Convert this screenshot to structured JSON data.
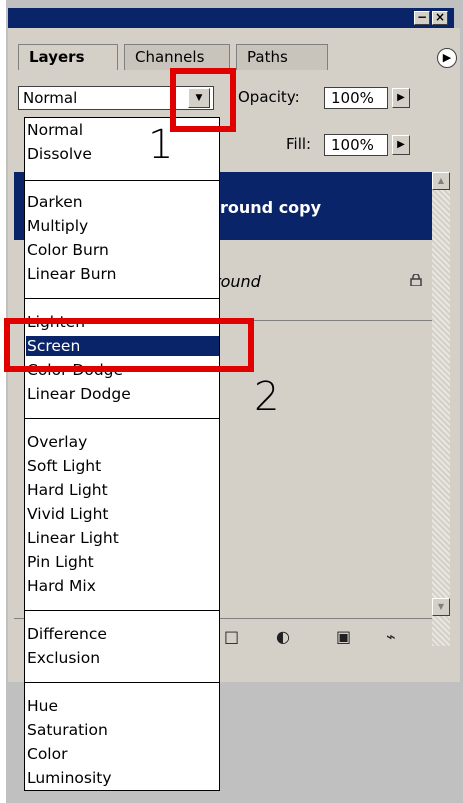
{
  "tabs": [
    {
      "label": "Layers"
    },
    {
      "label": "Channels"
    },
    {
      "label": "Paths"
    }
  ],
  "window_controls": {
    "minimize": "−",
    "close": "×"
  },
  "blend_mode": {
    "selected": "Normal"
  },
  "opacity": {
    "label": "Opacity:",
    "value": "100%"
  },
  "fill": {
    "label": "Fill:",
    "value": "100%"
  },
  "layers": [
    {
      "name": "round copy"
    },
    {
      "name": "round"
    }
  ],
  "dropdown_options": [
    {
      "label": "Normal"
    },
    {
      "label": "Dissolve"
    },
    {
      "label": "Darken"
    },
    {
      "label": "Multiply"
    },
    {
      "label": "Color Burn"
    },
    {
      "label": "Linear Burn"
    },
    {
      "label": "Lighten"
    },
    {
      "label": "Screen"
    },
    {
      "label": "Color Dodge"
    },
    {
      "label": "Linear Dodge"
    },
    {
      "label": "Overlay"
    },
    {
      "label": "Soft Light"
    },
    {
      "label": "Hard Light"
    },
    {
      "label": "Vivid Light"
    },
    {
      "label": "Linear Light"
    },
    {
      "label": "Pin Light"
    },
    {
      "label": "Hard Mix"
    },
    {
      "label": "Difference"
    },
    {
      "label": "Exclusion"
    },
    {
      "label": "Hue"
    },
    {
      "label": "Saturation"
    },
    {
      "label": "Color"
    },
    {
      "label": "Luminosity"
    }
  ],
  "annotations": {
    "step1": "1",
    "step2": "2"
  },
  "colors": {
    "highlight": "#0a246a",
    "annotation_box": "#e00000",
    "panel": "#d4d0c8"
  },
  "icons": [
    "triangle-down-icon",
    "triangle-right-icon",
    "lock-icon",
    "folder-icon",
    "adjustment-layer-icon",
    "new-layer-icon",
    "trash-icon",
    "panel-menu-icon"
  ]
}
